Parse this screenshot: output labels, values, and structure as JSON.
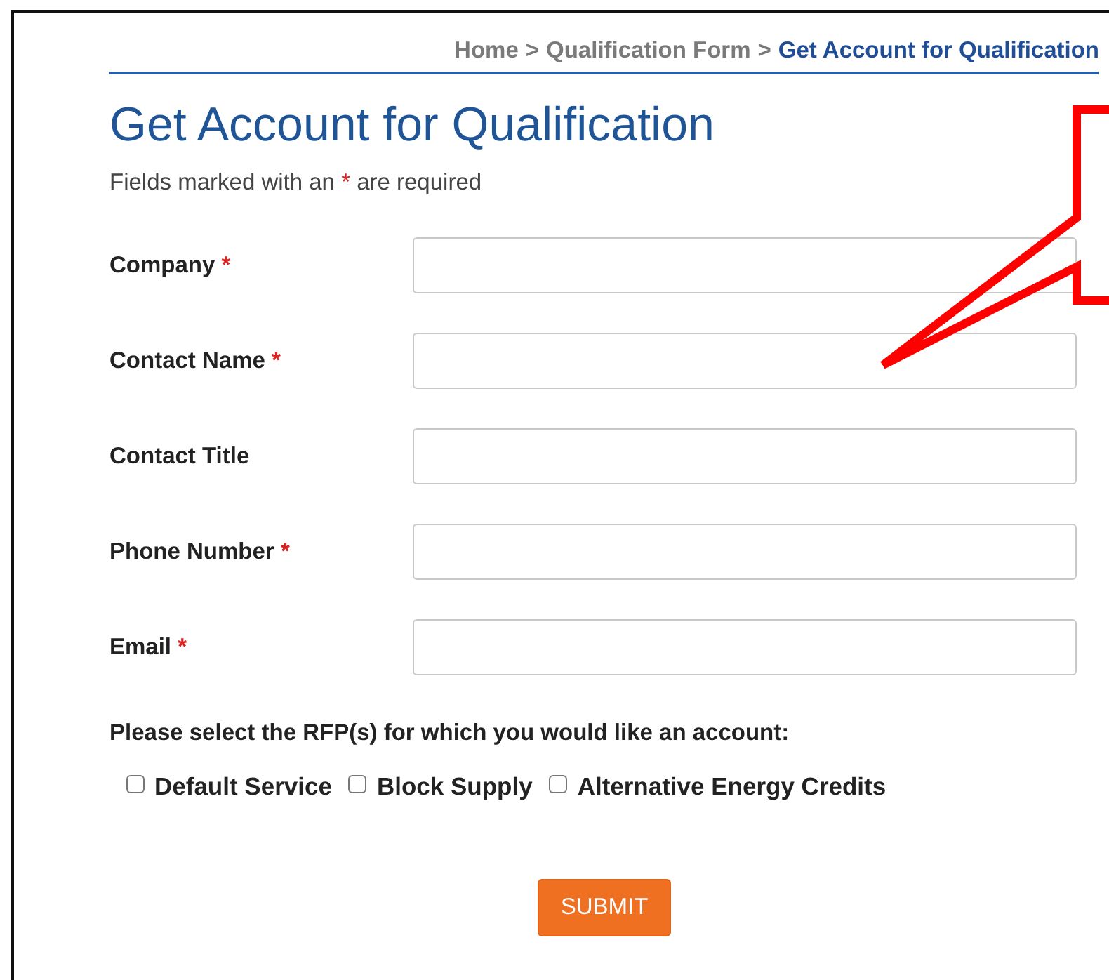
{
  "breadcrumb": [
    {
      "label": "Home",
      "selected": false
    },
    {
      "separator": ">"
    },
    {
      "label": "Qualification Form",
      "selected": false
    },
    {
      "separator": ">"
    },
    {
      "label": "Get Account for Qualification",
      "selected": true
    }
  ],
  "title": "Get Account for Qualification",
  "subtitle": {
    "before": "Fields marked with an",
    "mark": "*",
    "after": "are required"
  },
  "fields": [
    {
      "label": "Company",
      "required_mark": "*"
    },
    {
      "label": "Contact Name",
      "required_mark": "*"
    },
    {
      "label": "Contact Title"
    },
    {
      "label": "Phone Number",
      "required_mark": "*"
    },
    {
      "label": "Email",
      "required_mark": "*"
    }
  ],
  "rfp_question": "Please select the RFP(s) for which you would like an account:",
  "rfp_options": [
    {
      "label": "Default Service",
      "checked": false
    },
    {
      "label": "Block Supply",
      "checked": false
    },
    {
      "label": "Alternative Energy Credits",
      "checked": false
    }
  ],
  "submit_button": "SUBMIT"
}
